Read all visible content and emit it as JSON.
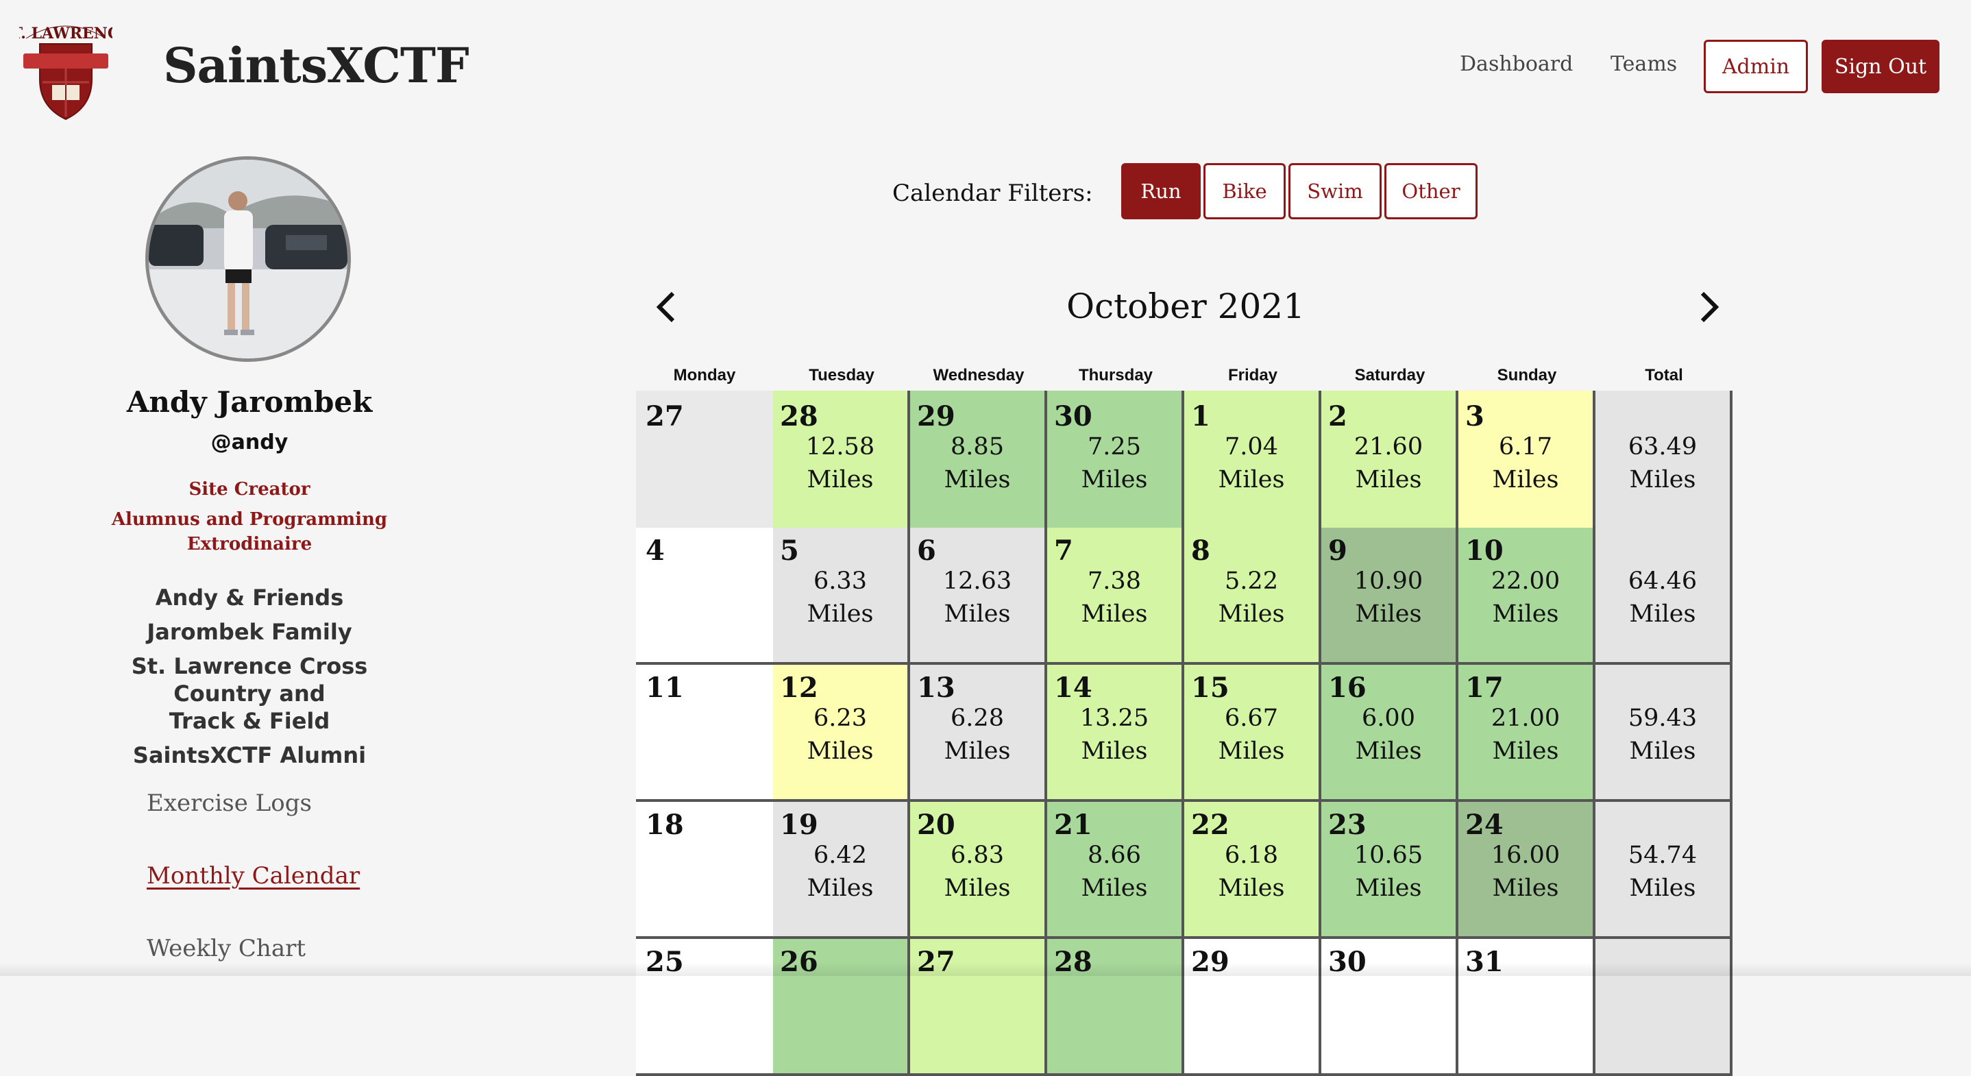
{
  "header": {
    "logo_text": "ST. LAWRENCE",
    "site_title": "SaintsXCTF",
    "nav": {
      "dashboard": "Dashboard",
      "teams": "Teams",
      "admin": "Admin",
      "sign_out": "Sign Out"
    }
  },
  "profile": {
    "name": "Andy Jarombek",
    "username": "@andy",
    "flair": [
      "Site Creator",
      "Alumnus and Programming",
      "Extrodinaire"
    ],
    "groups": [
      "Andy & Friends",
      "Jarombek Family",
      "St. Lawrence Cross Country and",
      "Track & Field",
      "SaintsXCTF Alumni"
    ],
    "links": {
      "exercise_logs": "Exercise Logs",
      "monthly_calendar": "Monthly Calendar",
      "weekly_chart": "Weekly Chart"
    }
  },
  "filters": {
    "label": "Calendar Filters:",
    "options": [
      "Run",
      "Bike",
      "Swim",
      "Other"
    ],
    "active": "Run"
  },
  "calendar": {
    "month_label": "October 2021",
    "unit": "Miles",
    "days_of_week": [
      "Monday",
      "Tuesday",
      "Wednesday",
      "Thursday",
      "Friday",
      "Saturday",
      "Sunday",
      "Total"
    ],
    "colors": {
      "none_past": "#e9e9e9",
      "none_current": "#ffffff",
      "gray": "#e4e4e4",
      "yellow": "#fefeb3",
      "lightgreen": "#d3f5a4",
      "green": "#a8d89a",
      "darkgreen": "#9dbf92",
      "total": "#e4e4e4"
    },
    "weeks": [
      [
        {
          "day": "27",
          "miles": "",
          "color": "none_past"
        },
        {
          "day": "28",
          "miles": "12.58",
          "color": "lightgreen"
        },
        {
          "day": "29",
          "miles": "8.85",
          "color": "green"
        },
        {
          "day": "30",
          "miles": "7.25",
          "color": "green"
        },
        {
          "day": "1",
          "miles": "7.04",
          "color": "lightgreen"
        },
        {
          "day": "2",
          "miles": "21.60",
          "color": "lightgreen"
        },
        {
          "day": "3",
          "miles": "6.17",
          "color": "yellow"
        },
        {
          "day": "",
          "miles": "63.49",
          "color": "total"
        }
      ],
      [
        {
          "day": "4",
          "miles": "",
          "color": "none_current"
        },
        {
          "day": "5",
          "miles": "6.33",
          "color": "gray"
        },
        {
          "day": "6",
          "miles": "12.63",
          "color": "gray"
        },
        {
          "day": "7",
          "miles": "7.38",
          "color": "lightgreen"
        },
        {
          "day": "8",
          "miles": "5.22",
          "color": "lightgreen"
        },
        {
          "day": "9",
          "miles": "10.90",
          "color": "darkgreen"
        },
        {
          "day": "10",
          "miles": "22.00",
          "color": "green"
        },
        {
          "day": "",
          "miles": "64.46",
          "color": "total"
        }
      ],
      [
        {
          "day": "11",
          "miles": "",
          "color": "none_current"
        },
        {
          "day": "12",
          "miles": "6.23",
          "color": "yellow"
        },
        {
          "day": "13",
          "miles": "6.28",
          "color": "gray"
        },
        {
          "day": "14",
          "miles": "13.25",
          "color": "lightgreen"
        },
        {
          "day": "15",
          "miles": "6.67",
          "color": "lightgreen"
        },
        {
          "day": "16",
          "miles": "6.00",
          "color": "green"
        },
        {
          "day": "17",
          "miles": "21.00",
          "color": "green"
        },
        {
          "day": "",
          "miles": "59.43",
          "color": "total"
        }
      ],
      [
        {
          "day": "18",
          "miles": "",
          "color": "none_current"
        },
        {
          "day": "19",
          "miles": "6.42",
          "color": "gray"
        },
        {
          "day": "20",
          "miles": "6.83",
          "color": "lightgreen"
        },
        {
          "day": "21",
          "miles": "8.66",
          "color": "green"
        },
        {
          "day": "22",
          "miles": "6.18",
          "color": "lightgreen"
        },
        {
          "day": "23",
          "miles": "10.65",
          "color": "green"
        },
        {
          "day": "24",
          "miles": "16.00",
          "color": "darkgreen"
        },
        {
          "day": "",
          "miles": "54.74",
          "color": "total"
        }
      ],
      [
        {
          "day": "25",
          "miles": "",
          "color": "none_current"
        },
        {
          "day": "26",
          "miles": "",
          "color": "green"
        },
        {
          "day": "27",
          "miles": "",
          "color": "lightgreen"
        },
        {
          "day": "28",
          "miles": "",
          "color": "green"
        },
        {
          "day": "29",
          "miles": "",
          "color": "none_current"
        },
        {
          "day": "30",
          "miles": "",
          "color": "none_current"
        },
        {
          "day": "31",
          "miles": "",
          "color": "none_current"
        },
        {
          "day": "",
          "miles": "",
          "color": "total"
        }
      ]
    ]
  }
}
